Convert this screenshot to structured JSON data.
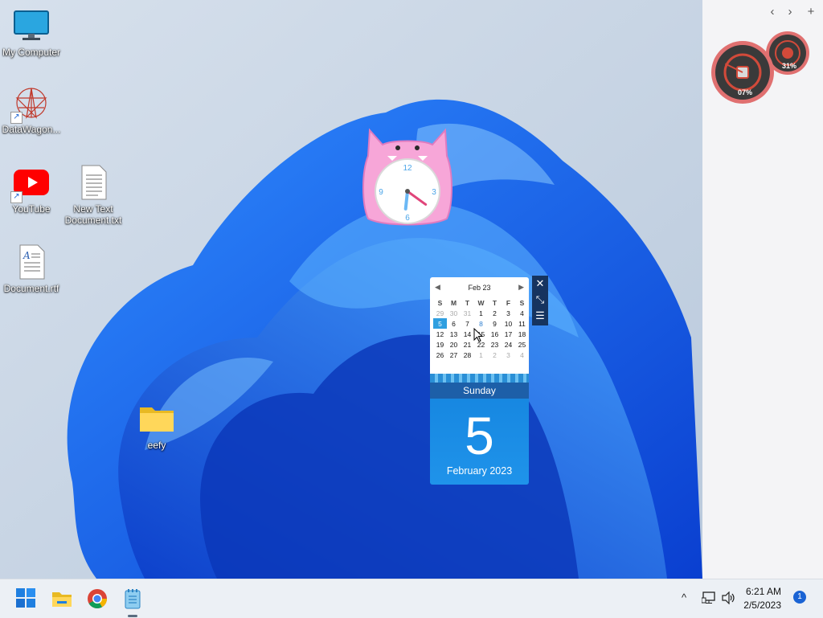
{
  "desktop": {
    "icons": [
      {
        "label": "My Computer"
      },
      {
        "label": "DataWagon..."
      },
      {
        "label": "YouTube"
      },
      {
        "label": "New Text\nDocument.txt"
      },
      {
        "label": "Document.rtf"
      },
      {
        "label": "eefy"
      }
    ]
  },
  "sidebar": {
    "prev": "‹",
    "next": "›",
    "add": "+"
  },
  "gauges": {
    "cpu_percent": "07%",
    "memory_percent": "31%",
    "cpu_value": 0.07,
    "memory_value": 0.31
  },
  "clock_widget": {
    "numerals": [
      "12",
      "3",
      "6",
      "9"
    ],
    "hour_hand_angle": 186,
    "minute_hand_angle": 126
  },
  "calendar": {
    "month_label": "Feb 23",
    "weekday_headers": [
      "S",
      "M",
      "T",
      "W",
      "T",
      "F",
      "S"
    ],
    "weeks": [
      [
        "29",
        "30",
        "31",
        "1",
        "2",
        "3",
        "4"
      ],
      [
        "5",
        "6",
        "7",
        "8",
        "9",
        "10",
        "11"
      ],
      [
        "12",
        "13",
        "14",
        "15",
        "16",
        "17",
        "18"
      ],
      [
        "19",
        "20",
        "21",
        "22",
        "23",
        "24",
        "25"
      ],
      [
        "26",
        "27",
        "28",
        "1",
        "2",
        "3",
        "4"
      ]
    ],
    "selected_day": "5",
    "weekday_name": "Sunday",
    "day_number": "5",
    "month_year": "February 2023"
  },
  "taskbar": {
    "pinned": [
      {
        "name": "start-icon"
      },
      {
        "name": "file-explorer-icon"
      },
      {
        "name": "chrome-icon"
      },
      {
        "name": "notepad-icon"
      }
    ],
    "tray": {
      "show_hidden": "^",
      "time": "6:21 AM",
      "date": "2/5/2023",
      "notification_count": "1"
    }
  },
  "colors": {
    "accent": "#1a63d4",
    "calendar_blue": "#1686e0",
    "gauge_red": "#d24a3a"
  }
}
